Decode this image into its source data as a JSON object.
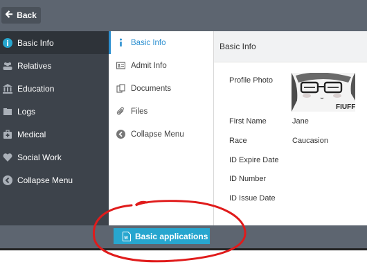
{
  "toolbar": {
    "back_label": "Back"
  },
  "sidebar": {
    "items": [
      {
        "label": "Basic Info",
        "icon": "info-circle-icon",
        "active": true
      },
      {
        "label": "Relatives",
        "icon": "users-icon"
      },
      {
        "label": "Education",
        "icon": "institution-icon"
      },
      {
        "label": "Logs",
        "icon": "folder-icon"
      },
      {
        "label": "Medical",
        "icon": "medkit-icon"
      },
      {
        "label": "Social Work",
        "icon": "heart-icon"
      },
      {
        "label": "Collapse Menu",
        "icon": "chevron-left-circle-icon"
      }
    ]
  },
  "submenu": {
    "items": [
      {
        "label": "Basic Info",
        "icon": "info-icon",
        "active": true
      },
      {
        "label": "Admit Info",
        "icon": "id-card-icon"
      },
      {
        "label": "Documents",
        "icon": "documents-icon"
      },
      {
        "label": "Files",
        "icon": "paperclip-icon"
      },
      {
        "label": "Collapse Menu",
        "icon": "chevron-left-circle-icon"
      }
    ]
  },
  "main": {
    "title": "Basic Info",
    "fields": [
      {
        "label": "Profile Photo",
        "value": ""
      },
      {
        "label": "First Name",
        "value": "Jane"
      },
      {
        "label": "Race",
        "value": "Caucasion"
      },
      {
        "label": "ID Expire Date",
        "value": ""
      },
      {
        "label": "ID Number",
        "value": ""
      },
      {
        "label": "ID Issue Date",
        "value": ""
      }
    ],
    "photo_caption": "FIUFF"
  },
  "footer": {
    "apps_label": "Basic applications",
    "apps_icon": "word-doc-icon"
  },
  "colors": {
    "accent": "#2b8fd0",
    "button": "#27a6cf",
    "annotation": "#e01b1b"
  }
}
